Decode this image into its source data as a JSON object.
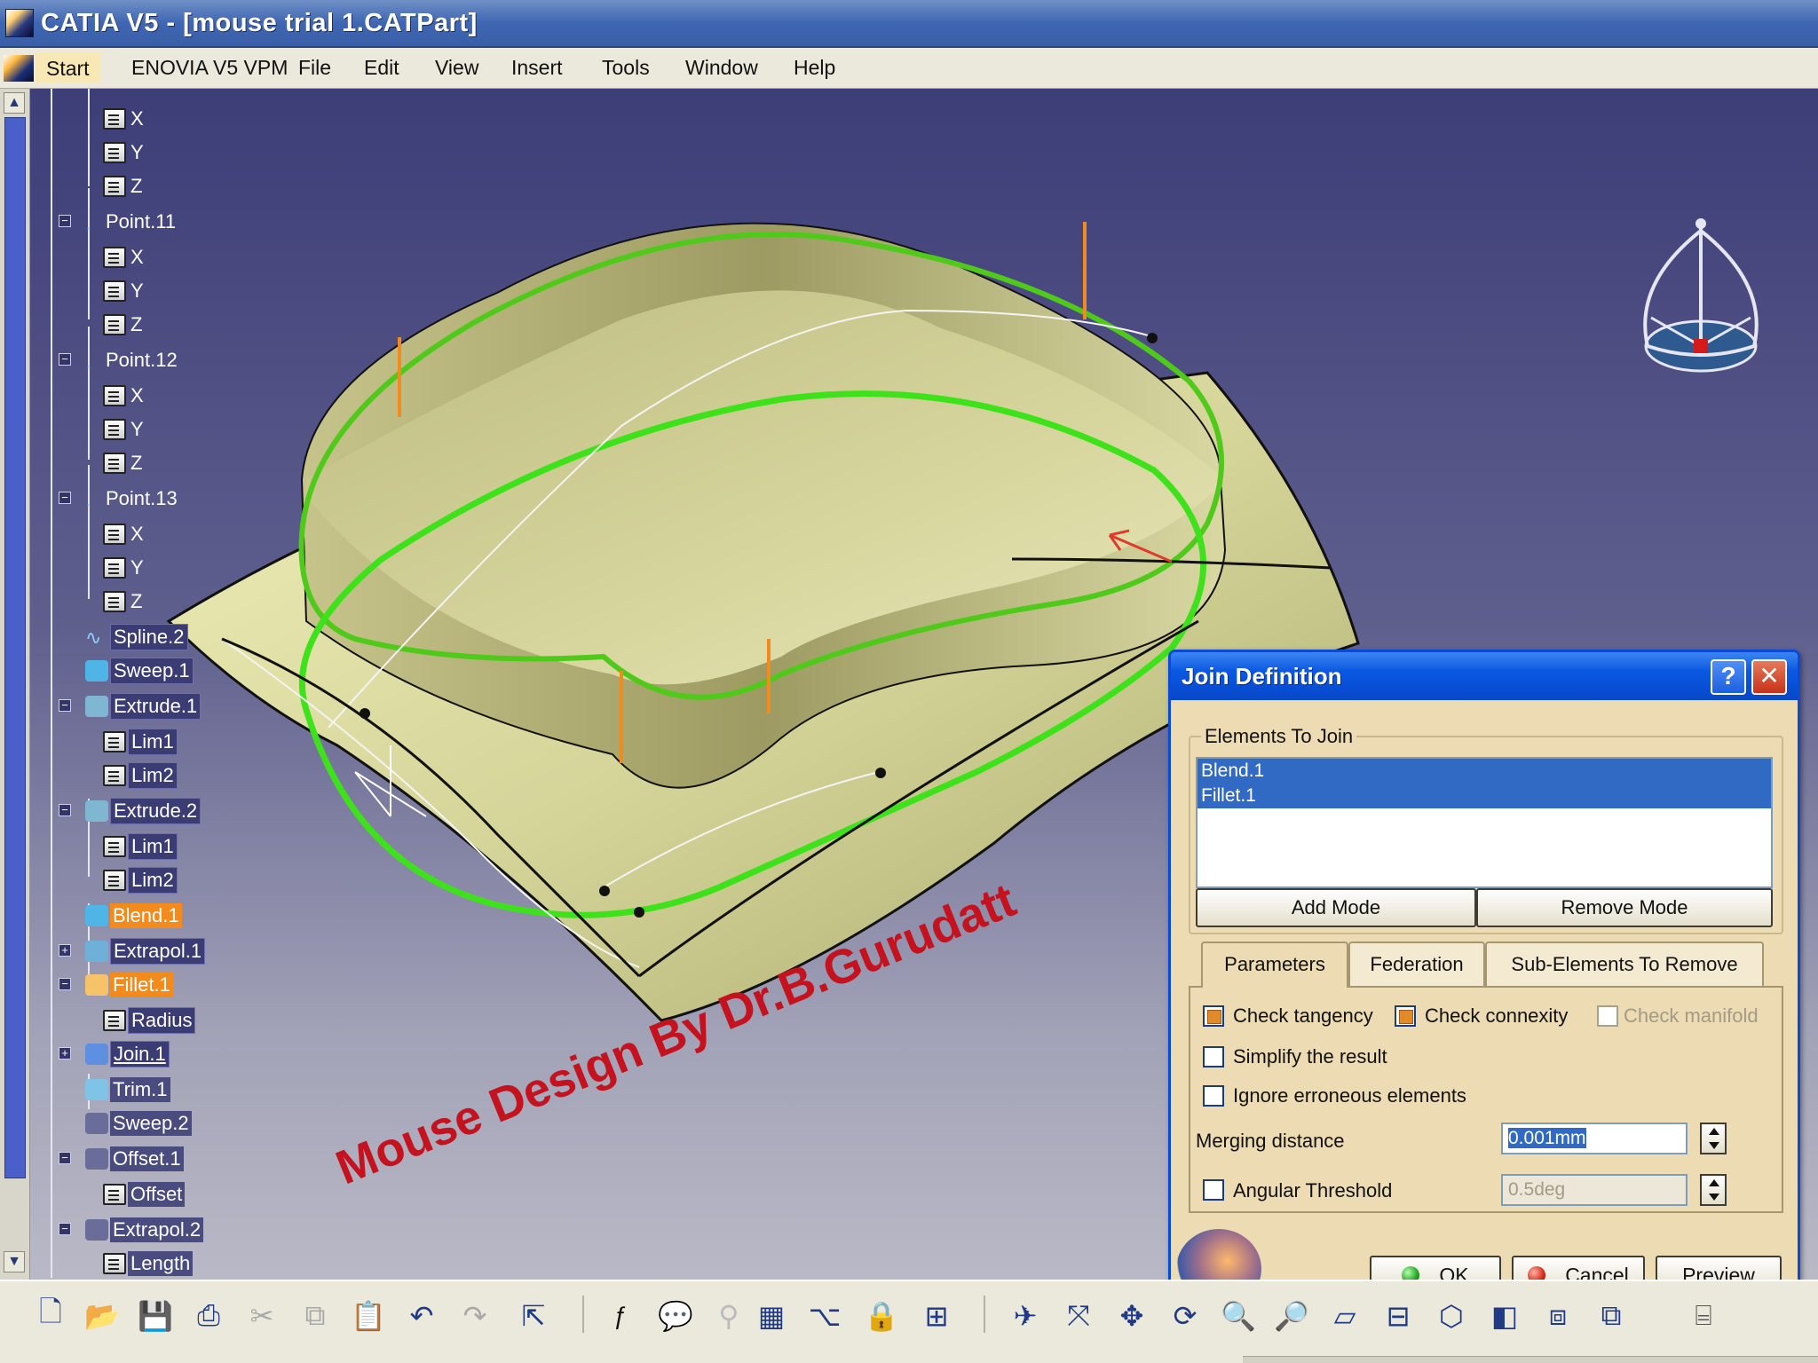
{
  "window": {
    "title": "CATIA V5 - [mouse trial 1.CATPart]"
  },
  "menu": {
    "items": [
      {
        "label": "Start",
        "key": "S"
      },
      {
        "label": "ENOVIA V5 VPM",
        "key": ""
      },
      {
        "label": "File",
        "key": "F"
      },
      {
        "label": "Edit",
        "key": "E"
      },
      {
        "label": "View",
        "key": "V"
      },
      {
        "label": "Insert",
        "key": "I"
      },
      {
        "label": "Tools",
        "key": "T"
      },
      {
        "label": "Window",
        "key": "W"
      },
      {
        "label": "Help",
        "key": "H"
      }
    ]
  },
  "tree": {
    "nodes": [
      {
        "label": "X",
        "icon": "parameter-icon"
      },
      {
        "label": "Y",
        "icon": "parameter-icon"
      },
      {
        "label": "Z",
        "icon": "parameter-icon"
      },
      {
        "label": "Point.11",
        "icon": "point-icon"
      },
      {
        "label": "X",
        "icon": "parameter-icon"
      },
      {
        "label": "Y",
        "icon": "parameter-icon"
      },
      {
        "label": "Z",
        "icon": "parameter-icon"
      },
      {
        "label": "Point.12",
        "icon": "point-icon"
      },
      {
        "label": "X",
        "icon": "parameter-icon"
      },
      {
        "label": "Y",
        "icon": "parameter-icon"
      },
      {
        "label": "Z",
        "icon": "parameter-icon"
      },
      {
        "label": "Point.13",
        "icon": "point-icon"
      },
      {
        "label": "X",
        "icon": "parameter-icon"
      },
      {
        "label": "Y",
        "icon": "parameter-icon"
      },
      {
        "label": "Z",
        "icon": "parameter-icon"
      },
      {
        "label": "Spline.2",
        "icon": "spline-icon"
      },
      {
        "label": "Sweep.1",
        "icon": "sweep-icon"
      },
      {
        "label": "Extrude.1",
        "icon": "extrude-icon"
      },
      {
        "label": "Lim1",
        "icon": "parameter-icon"
      },
      {
        "label": "Lim2",
        "icon": "parameter-icon"
      },
      {
        "label": "Extrude.2",
        "icon": "extrude-icon"
      },
      {
        "label": "Lim1",
        "icon": "parameter-icon"
      },
      {
        "label": "Lim2",
        "icon": "parameter-icon"
      },
      {
        "label": "Blend.1",
        "icon": "blend-icon"
      },
      {
        "label": "Extrapol.1",
        "icon": "extrapolate-icon"
      },
      {
        "label": "Fillet.1",
        "icon": "fillet-icon"
      },
      {
        "label": "Radius",
        "icon": "parameter-icon"
      },
      {
        "label": "Join.1",
        "icon": "join-icon"
      },
      {
        "label": "Trim.1",
        "icon": "trim-icon"
      },
      {
        "label": "Sweep.2",
        "icon": "sweep-icon"
      },
      {
        "label": "Offset.1",
        "icon": "offset-icon"
      },
      {
        "label": "Offset",
        "icon": "parameter-icon"
      },
      {
        "label": "Extrapol.2",
        "icon": "extrapolate-icon"
      },
      {
        "label": "Length",
        "icon": "parameter-icon"
      }
    ]
  },
  "watermark": "Mouse Design By Dr.B.Gurudatt",
  "colors": {
    "highlight": "#f38a1c",
    "surface": "#d9d9a0",
    "boundary": "#5fd21c",
    "watermark": "#c4121f",
    "selection": "#316ac5"
  },
  "dialog": {
    "title": "Join Definition",
    "help_label": "?",
    "close_label": "✕",
    "elements_group": "Elements To Join",
    "elements": [
      "Blend.1",
      "Fillet.1"
    ],
    "add_mode": "Add Mode",
    "remove_mode": "Remove Mode",
    "tabs": [
      "Parameters",
      "Federation",
      "Sub-Elements To Remove"
    ],
    "check_tangency": {
      "label": "Check tangency",
      "checked": true
    },
    "check_connexity": {
      "label": "Check connexity",
      "checked": true
    },
    "check_manifold": {
      "label": "Check manifold",
      "checked": false,
      "disabled": true
    },
    "simplify": {
      "label": "Simplify the result",
      "checked": false
    },
    "ignore": {
      "label": "Ignore erroneous elements",
      "checked": false
    },
    "merging_label": "Merging distance",
    "merging_value": "0.001mm",
    "angular_label": "Angular Threshold",
    "angular_value": "0.5deg",
    "ok": "OK",
    "cancel": "Cancel",
    "preview": "Preview"
  },
  "toolbar": {
    "icons": [
      "new-icon",
      "open-icon",
      "save-icon",
      "print-icon",
      "cut-icon",
      "copy-icon",
      "paste-icon",
      "undo-icon",
      "redo-icon",
      "whats-this-icon",
      "formula-icon",
      "comment-icon",
      "knowledge-icon",
      "table-icon",
      "tree-icon",
      "lock-icon",
      "catalog-icon",
      "fly-mode-icon",
      "fit-all-icon",
      "pan-icon",
      "rotate-icon",
      "zoom-in-icon",
      "zoom-out-icon",
      "normal-view-icon",
      "multi-view-icon",
      "iso-view-icon",
      "shading-icon",
      "hide-show-icon",
      "swap-space-icon",
      "render-icon"
    ]
  }
}
